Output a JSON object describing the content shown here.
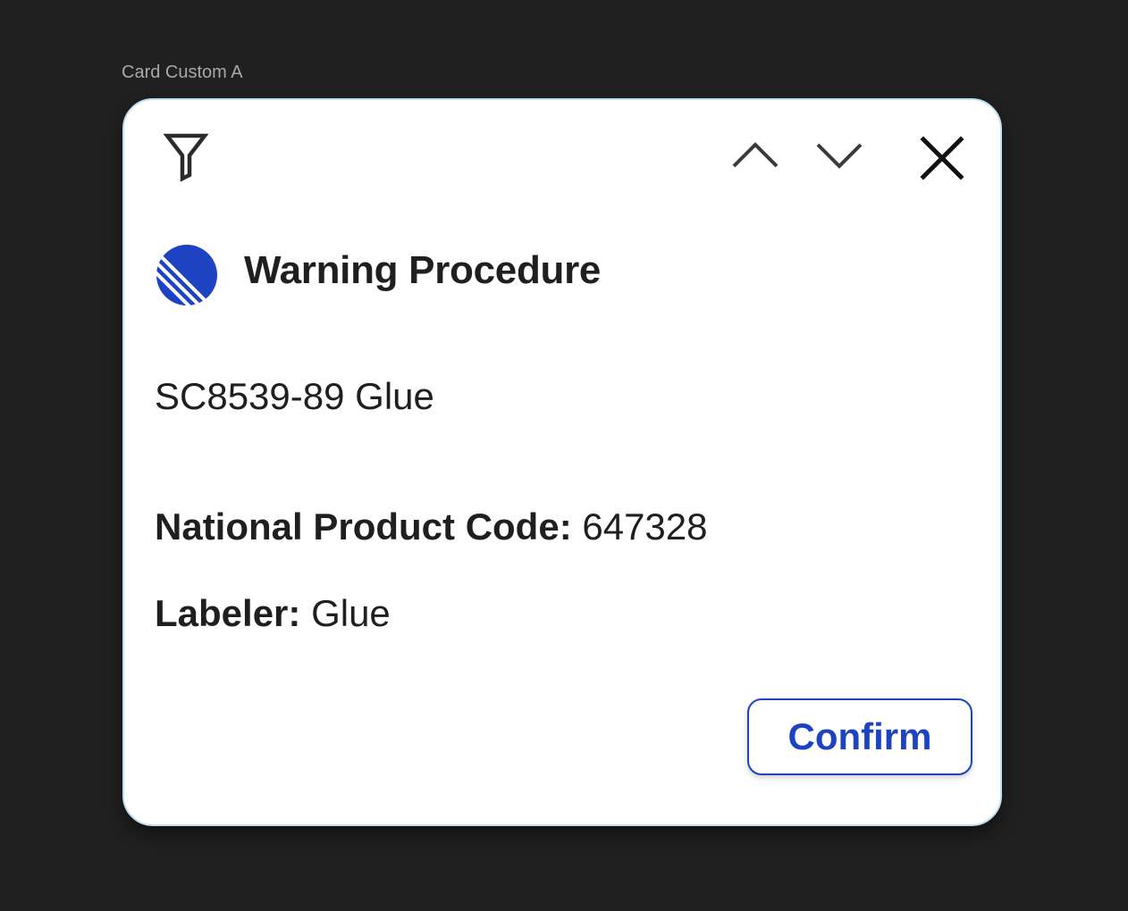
{
  "frame": {
    "label": "Card Custom A"
  },
  "card": {
    "toolbar": {
      "filter_icon": "filter-icon",
      "up_icon": "chevron-up-icon",
      "down_icon": "chevron-down-icon",
      "close_icon": "close-icon"
    },
    "header": {
      "logo_icon": "striped-circle-logo",
      "title": "Warning Procedure"
    },
    "product_name": "SC8539-89 Glue",
    "fields": {
      "code": {
        "label": "National Product Code:",
        "value": "647328"
      },
      "labeler": {
        "label": "Labeler:",
        "value": "Glue"
      }
    },
    "actions": {
      "confirm_label": "Confirm"
    }
  },
  "colors": {
    "background": "#202020",
    "card_border": "#bfe0f2",
    "accent": "#1d43c2",
    "text": "#1f1f1f"
  }
}
